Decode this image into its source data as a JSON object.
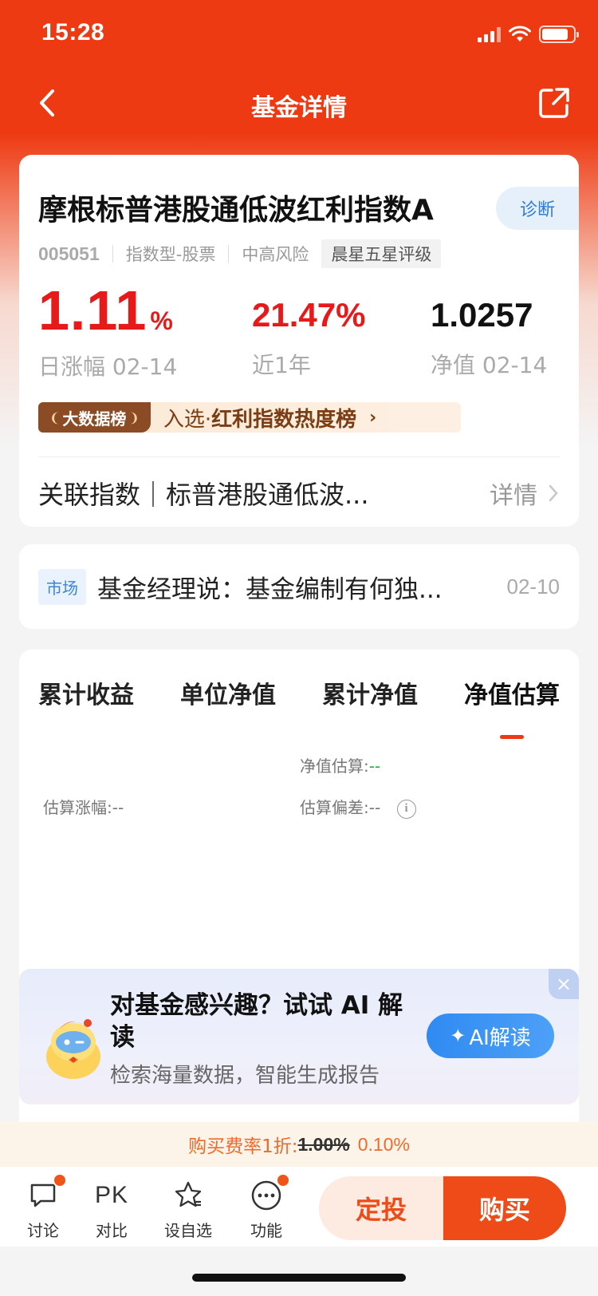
{
  "status_bar": {
    "time": "15:28"
  },
  "nav": {
    "title": "基金详情"
  },
  "fund": {
    "name": "摩根标普港股通低波红利指数A",
    "diagnose_label": "诊断",
    "code": "005051",
    "type": "指数型-股票",
    "risk": "中高风险",
    "rating": "晨星五星评级",
    "daily_change_value": "1.11",
    "daily_change_unit": "%",
    "daily_change_label": "日涨幅 02-14",
    "year_return": "21.47%",
    "year_label": "近1年",
    "nav_value": "1.0257",
    "nav_label": "净值 02-14"
  },
  "rank_banner": {
    "badge": "大数据榜",
    "prefix": "入选·",
    "text": "红利指数热度榜",
    "arrow": "›"
  },
  "related_index": {
    "label": "关联指数｜标普港股通低波...",
    "detail": "详情"
  },
  "news": {
    "tag": "市场",
    "title": "基金经理说：基金编制有何独...",
    "date": "02-10"
  },
  "chart_tabs": [
    {
      "label": "累计收益"
    },
    {
      "label": "单位净值"
    },
    {
      "label": "累计净值"
    },
    {
      "label": "净值估算"
    }
  ],
  "estimate": {
    "nav_label": "净值估算:",
    "nav_value": "--",
    "change_label": "估算涨幅:",
    "change_value": "--",
    "deviation_label": "估算偏差:",
    "deviation_value": "--",
    "info": "i"
  },
  "ai_promo": {
    "title": "对基金感兴趣？试试 AI 解读",
    "subtitle": "检索海量数据，智能生成报告",
    "button": "AI解读",
    "close": "×"
  },
  "fee": {
    "label": "购买费率1折:",
    "old": "1.00%",
    "new": "0.10%"
  },
  "tabbar": {
    "discuss": "讨论",
    "compare_icon": "PK",
    "compare": "对比",
    "watchlist": "设自选",
    "functions": "功能",
    "sip": "定投",
    "buy": "购买"
  },
  "colors": {
    "brand": "#ee3a12",
    "up": "#e81919",
    "accent_blue": "#2f7ad3"
  }
}
